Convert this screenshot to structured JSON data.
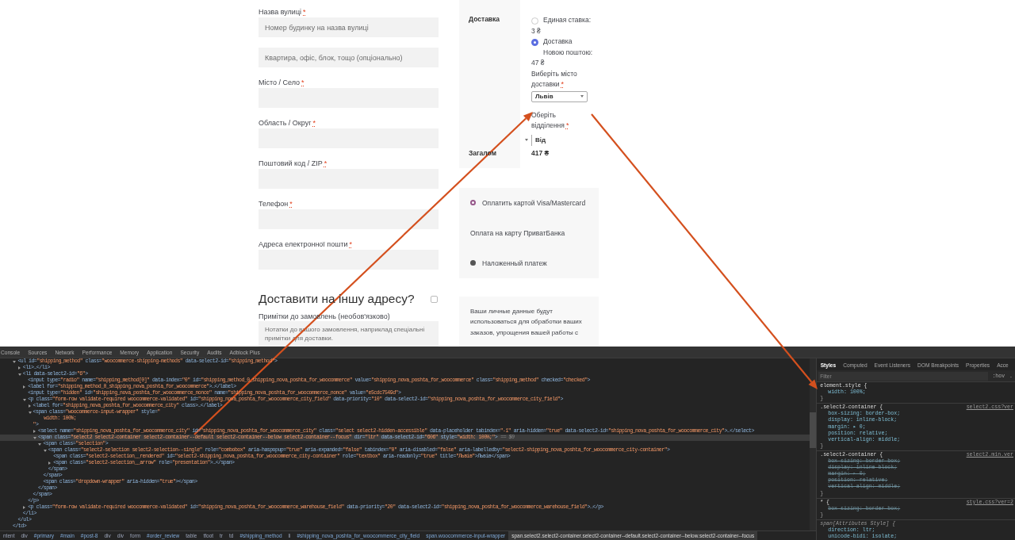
{
  "checkout_form": {
    "fields": [
      {
        "label": "Назва вулиці",
        "required_mark": "*",
        "placeholder": "Номер будинку на назва вулиці"
      },
      {
        "placeholder": "Квартира, офіс, блок, тощо (опціонально)"
      },
      {
        "label": "Місто / Село",
        "required_mark": "*"
      },
      {
        "label": "Область / Округ",
        "required_mark": "*"
      },
      {
        "label": "Поштовий код / ZIP",
        "required_mark": "*"
      },
      {
        "label": "Телефон",
        "required_mark": "*"
      },
      {
        "label": "Адреса електронної пошти",
        "required_mark": "*"
      }
    ],
    "ship_elsewhere": {
      "heading": "Доставити на іншу адресу?",
      "checked": false
    },
    "notes": {
      "label": "Примітки до замовлень (необов'язково)",
      "placeholder": "Нотатки до вашого замовлення, наприклад спеціальні примітки для доставки."
    }
  },
  "order_review": {
    "shipping": {
      "label": "Доставка",
      "options": [
        {
          "label": "Единая ставка:",
          "price": "3 ₴",
          "selected": false
        },
        {
          "label": "Доставка Новою поштою:",
          "price": "47 ₴",
          "selected": true
        }
      ],
      "city": {
        "label": "Виберіть місто доставки",
        "required_mark": "*",
        "value": "Львів"
      },
      "warehouse": {
        "label": "Оберіть відділення",
        "required_mark": "*",
        "value": "Від"
      }
    },
    "total": {
      "label": "Загалом",
      "value": "417 ₴"
    }
  },
  "payment_methods": [
    {
      "kind": "radio",
      "label": "Оплатить картой Visa/Mastercard",
      "selected": true
    },
    {
      "kind": "plain",
      "label": "Оплата на карту ПриватБанка",
      "selected": false
    },
    {
      "kind": "radio",
      "label": "Наложенный платеж",
      "selected": false
    }
  ],
  "privacy_note": "Ваши личные данные будут использоваться для обработки ваших заказов, упрощения вашей работы с",
  "devtools": {
    "tabs": [
      {
        "label": "Console",
        "selected": false
      },
      {
        "label": "Sources",
        "selected": false
      },
      {
        "label": "Network",
        "selected": false
      },
      {
        "label": "Performance",
        "selected": false
      },
      {
        "label": "Memory",
        "selected": false
      },
      {
        "label": "Application",
        "selected": false
      },
      {
        "label": "Security",
        "selected": false
      },
      {
        "label": "Audits",
        "selected": false
      },
      {
        "label": "Adblock Plus",
        "selected": false
      }
    ],
    "dom_tree": {
      "close": "</td>",
      "selected": false,
      "expanded": true,
      "children": [
        {
          "open": "<ul id=\"shipping_method\" class=\"woocommerce-shipping-methods\" data-select2-id=\"shipping_method\">",
          "close": "</ul>",
          "expanded": true,
          "selected": false,
          "children": [
            {
              "open": "<li>…</li>",
              "expanded": false,
              "selected": false
            },
            {
              "open": "<li data-select2-id=\"6\">",
              "close": "</li>",
              "expanded": true,
              "selected": false,
              "children": [
                {
                  "open": "<input type=\"radio\" name=\"shipping_method[0]\" data-index=\"0\" id=\"shipping_method_0_shipping_nova_poshta_for_woocommerce\" value=\"shipping_nova_poshta_for_woocommerce\" class=\"shipping_method\" checked=\"checked\">",
                  "selected": false
                },
                {
                  "open": "<label for=\"shipping_method_0_shipping_nova_poshta_for_woocommerce\">…</label>",
                  "expanded": false,
                  "selected": false
                },
                {
                  "open": "<input type=\"hidden\" id=\"shipping_nova_poshta_for_woocommerce_nonce\" name=\"shipping_nova_poshta_for_woocommerce_nonce\" value=\"e5cdc7549d\">",
                  "selected": false
                },
                {
                  "open": "<p class=\"form-row validate-required woocommerce-validated\" id=\"shipping_nova_poshta_for_woocommerce_city_field\" data-priority=\"10\" data-select2-id=\"shipping_nova_poshta_for_woocommerce_city_field\">",
                  "close": "</p>",
                  "expanded": true,
                  "selected": false,
                  "children": [
                    {
                      "open": "<label for=\"shipping_nova_poshta_for_woocommerce_city\" class>…</label>",
                      "expanded": false,
                      "selected": false
                    },
                    {
                      "open": "<span class=\"woocommerce-input-wrapper\" style=\"\n    width: 100%;\n\">",
                      "close": "</span>",
                      "expanded": true,
                      "selected": false,
                      "children": [
                        {
                          "open": "<select name=\"shipping_nova_poshta_for_woocommerce_city\" id=\"shipping_nova_poshta_for_woocommerce_city\" class=\"select select2-hidden-accessible\" data-placeholder tabindex=\"-1\" aria-hidden=\"true\" data-select2-id=\"shipping_nova_poshta_for_woocommerce_city\">…</select>",
                          "expanded": false,
                          "selected": false
                        },
                        {
                          "open": "<span class=\"select2 select2-container select2-container--default select2-container--below select2-container--focus\" dir=\"ltr\" data-select2-id=\"606\" style=\"width: 100%;\">",
                          "marker": "== $0",
                          "close": "</span>",
                          "expanded": true,
                          "selected": true,
                          "children": [
                            {
                              "open": "<span class=\"selection\">",
                              "close": "</span>",
                              "expanded": true,
                              "selected": false,
                              "children": [
                                {
                                  "open": "<span class=\"select2-selection select2-selection--single\" role=\"combobox\" aria-haspopup=\"true\" aria-expanded=\"false\" tabindex=\"0\" aria-disabled=\"false\" aria-labelledby=\"select2-shipping_nova_poshta_for_woocommerce_city-container\">",
                                  "close": "</span>",
                                  "expanded": true,
                                  "selected": false,
                                  "children": [
                                    {
                                      "open": "<span class=\"select2-selection__rendered\" id=\"select2-shipping_nova_poshta_for_woocommerce_city-container\" role=\"textbox\" aria-readonly=\"true\" title=\"Львів\">Львів</span>",
                                      "selected": false
                                    },
                                    {
                                      "open": "<span class=\"select2-selection__arrow\" role=\"presentation\">…</span>",
                                      "expanded": false,
                                      "selected": false
                                    }
                                  ]
                                }
                              ]
                            },
                            {
                              "open": "<span class=\"dropdown-wrapper\" aria-hidden=\"true\"></span>",
                              "selected": false
                            }
                          ]
                        }
                      ]
                    }
                  ]
                },
                {
                  "open": "<p class=\"form-row validate-required woocommerce-validated\" id=\"shipping_nova_poshta_for_woocommerce_warehouse_field\" data-priority=\"20\" data-select2-id=\"shipping_nova_poshta_for_woocommerce_warehouse_field\">…</p>",
                  "expanded": false,
                  "selected": false
                }
              ]
            }
          ]
        }
      ]
    },
    "breadcrumbs": [
      {
        "label": "ntent",
        "kind": "tag",
        "selected": false
      },
      {
        "label": "div",
        "kind": "tag",
        "selected": false
      },
      {
        "label": "#primary",
        "kind": "id",
        "selected": false
      },
      {
        "label": "#main",
        "kind": "id",
        "selected": false
      },
      {
        "label": "#post-8",
        "kind": "id",
        "selected": false
      },
      {
        "label": "div",
        "kind": "tag",
        "selected": false
      },
      {
        "label": "div",
        "kind": "tag",
        "selected": false
      },
      {
        "label": "form",
        "kind": "tag",
        "selected": false
      },
      {
        "label": "#order_review",
        "kind": "id",
        "selected": false
      },
      {
        "label": "table",
        "kind": "tag",
        "selected": false
      },
      {
        "label": "tfoot",
        "kind": "tag",
        "selected": false
      },
      {
        "label": "tr",
        "kind": "tag",
        "selected": false
      },
      {
        "label": "td",
        "kind": "tag",
        "selected": false
      },
      {
        "label": "#shipping_method",
        "kind": "id",
        "selected": false
      },
      {
        "label": "li",
        "kind": "tag",
        "selected": false
      },
      {
        "label": "#shipping_nova_poshta_for_woocommerce_city_field",
        "kind": "id",
        "selected": false
      },
      {
        "label": "span.woocommerce-input-wrapper",
        "kind": "id",
        "selected": false
      },
      {
        "label": "span.select2.select2-container.select2-container--default.select2-container--below.select2-container--focus",
        "kind": "id",
        "selected": true
      }
    ],
    "styles_panel": {
      "tabs": [
        {
          "label": "Styles",
          "selected": true
        },
        {
          "label": "Computed",
          "selected": false
        },
        {
          "label": "Event Listeners",
          "selected": false
        },
        {
          "label": "DOM Breakpoints",
          "selected": false
        },
        {
          "label": "Properties",
          "selected": false
        },
        {
          "label": "Acce",
          "selected": false
        }
      ],
      "filter": {
        "placeholder": "Filter"
      },
      "toggles": [
        ":hov",
        "."
      ],
      "rules": [
        {
          "selector": "element.style {",
          "close": "}",
          "properties": [
            {
              "text": "width: 100%;",
              "overridden": false
            }
          ]
        },
        {
          "selector": ".select2-container {",
          "source": "select2.css?ver",
          "close": "}",
          "properties": [
            {
              "text": "box-sizing: border-box;",
              "overridden": false
            },
            {
              "text": "display: inline-block;",
              "overridden": false
            },
            {
              "text": "margin: ▸ 0;",
              "overridden": false
            },
            {
              "text": "position: relative;",
              "overridden": false
            },
            {
              "text": "vertical-align: middle;",
              "overridden": false
            }
          ]
        },
        {
          "selector": ".select2-container {",
          "source": "select2.min.ver",
          "close": "}",
          "properties": [
            {
              "text": "box-sizing: border-box;",
              "overridden": true
            },
            {
              "text": "display: inline-block;",
              "overridden": true
            },
            {
              "text": "margin: ▸ 0;",
              "overridden": true
            },
            {
              "text": "position: relative;",
              "overridden": true
            },
            {
              "text": "vertical-align: middle;",
              "overridden": true
            }
          ]
        },
        {
          "selector": "* {",
          "source": "style.css?ver=2",
          "close": "}",
          "properties": [
            {
              "text": "box-sizing: border-box;",
              "overridden": true
            }
          ]
        },
        {
          "selector": "span[Attributes Style] {",
          "kind": "user-agent",
          "properties": [
            {
              "text": "direction: ltr;",
              "overridden": false
            },
            {
              "text": "unicode-bidi: isolate;",
              "overridden": false
            }
          ]
        }
      ]
    }
  }
}
